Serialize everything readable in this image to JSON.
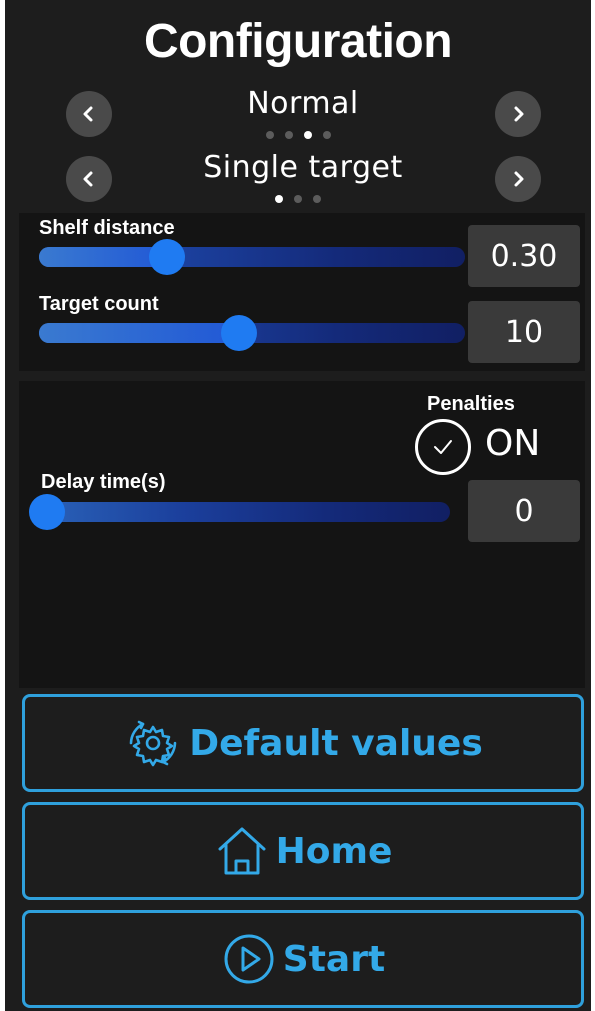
{
  "header": {
    "title": "Configuration"
  },
  "mode_selector": {
    "value": "Normal",
    "page_count": 4,
    "active_index": 2
  },
  "target_selector": {
    "value": "Single target",
    "page_count": 3,
    "active_index": 0
  },
  "sliders": {
    "shelf_distance": {
      "label": "Shelf distance",
      "value": "0.30",
      "fraction": 0.3
    },
    "target_count": {
      "label": "Target count",
      "value": "10",
      "fraction": 0.47
    },
    "delay_time": {
      "label": "Delay time(s)",
      "value": "0",
      "fraction": 0.0
    }
  },
  "penalties": {
    "label": "Penalties",
    "state": "ON"
  },
  "buttons": {
    "default_values": "Default values",
    "home": "Home",
    "start": "Start"
  },
  "colors": {
    "accent": "#33a9e8",
    "slider_thumb": "#1f7bf2",
    "background": "#1d1d1d"
  },
  "icons": {
    "prev": "chevron-left-icon",
    "next": "chevron-right-icon",
    "check": "check-circle-icon",
    "default_values": "gear-refresh-icon",
    "home": "home-icon",
    "start": "play-circle-icon"
  }
}
